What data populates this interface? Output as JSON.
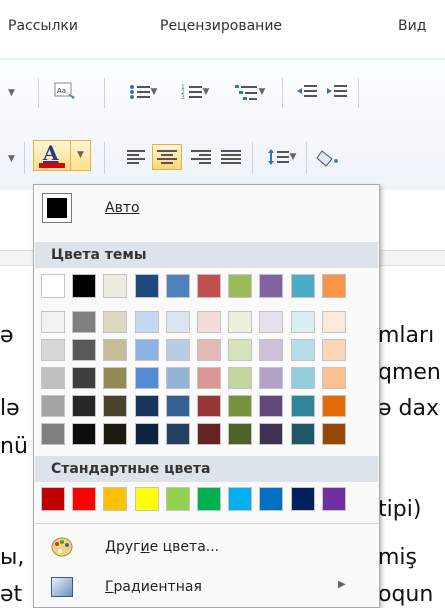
{
  "ribbon": {
    "tabs": [
      "Рассылки",
      "Рецензирование",
      "Вид"
    ]
  },
  "font_color_button": {
    "glyph": "A",
    "color": "#e00000"
  },
  "document": {
    "lines": [
      {
        "left": "ә",
        "right": "mları"
      },
      {
        "left": "",
        "right": "qmen"
      },
      {
        "left": "lә",
        "right": "ә dax"
      },
      {
        "left": "nü",
        "right": ""
      },
      {
        "left": "",
        "right": "tipi)"
      },
      {
        "left": "ы,",
        "right": "miş"
      },
      {
        "left": "әt",
        "right": "oqun"
      }
    ]
  },
  "color_panel": {
    "auto_label": "Авто",
    "auto_color": "#000000",
    "theme_header": "Цвета темы",
    "theme_colors": [
      "#ffffff",
      "#000000",
      "#eeece1",
      "#1f497d",
      "#4f81bd",
      "#c0504d",
      "#9bbb59",
      "#8064a2",
      "#4bacc6",
      "#f79646"
    ],
    "theme_shades": [
      [
        "#f2f2f2",
        "#d8d8d8",
        "#bfbfbf",
        "#a5a5a5",
        "#7f7f7f"
      ],
      [
        "#7f7f7f",
        "#595959",
        "#3f3f3f",
        "#262626",
        "#0c0c0c"
      ],
      [
        "#ddd9c3",
        "#c4bd97",
        "#938953",
        "#494429",
        "#1d1b10"
      ],
      [
        "#c6d9f0",
        "#8db3e2",
        "#548dd4",
        "#17365d",
        "#0f243e"
      ],
      [
        "#dbe5f1",
        "#b8cce4",
        "#95b3d7",
        "#366092",
        "#244061"
      ],
      [
        "#f2dcdb",
        "#e5b9b7",
        "#d99694",
        "#953734",
        "#632423"
      ],
      [
        "#ebf1dd",
        "#d7e3bc",
        "#c3d69b",
        "#76923c",
        "#4f6128"
      ],
      [
        "#e5e0ec",
        "#ccc1d9",
        "#b2a2c7",
        "#5f497a",
        "#3f3151"
      ],
      [
        "#dbeef3",
        "#b7dde8",
        "#92cddc",
        "#31859b",
        "#205867"
      ],
      [
        "#fdeada",
        "#fbd5b5",
        "#fac08f",
        "#e36c09",
        "#974806"
      ]
    ],
    "standard_header": "Стандартные цвета",
    "standard_colors": [
      "#c00000",
      "#ff0000",
      "#ffc000",
      "#ffff00",
      "#92d050",
      "#00b050",
      "#00b0f0",
      "#0070c0",
      "#002060",
      "#7030a0"
    ],
    "more_colors": {
      "pre": "Друг",
      "ul": "и",
      "post": "е цвета..."
    },
    "gradient": {
      "ul": "Г",
      "rest": "радиентная"
    }
  }
}
